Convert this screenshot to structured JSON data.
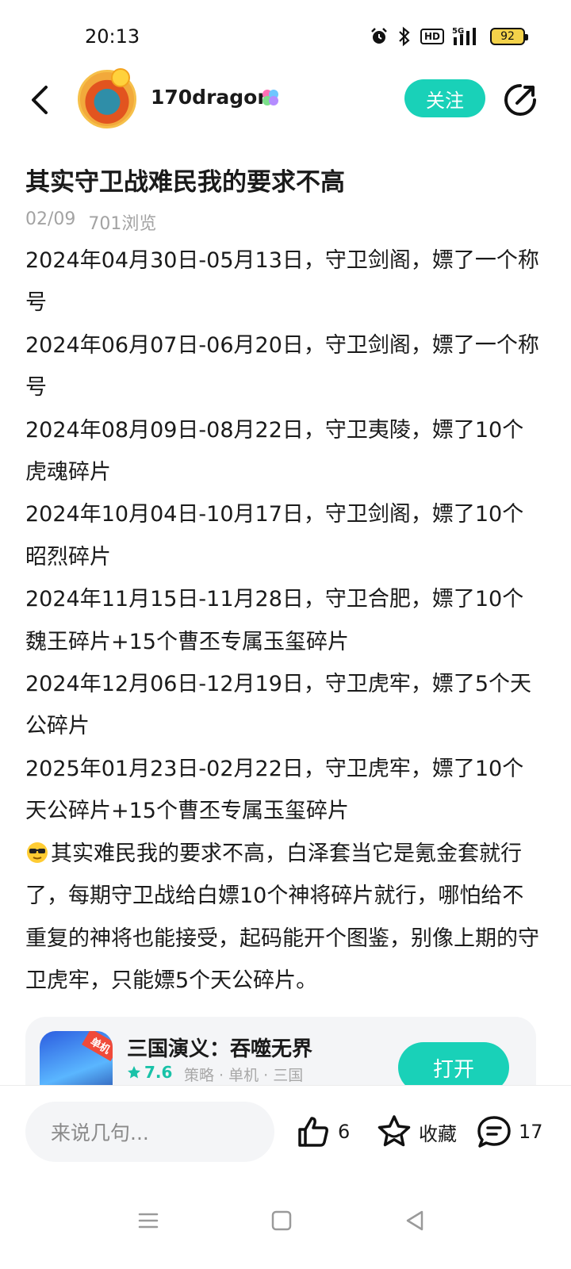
{
  "status_bar": {
    "time": "20:13",
    "network": "5G",
    "hd_label": "HD",
    "battery": "92",
    "icons": [
      "alarm-icon",
      "bluetooth-icon",
      "hd-icon",
      "signal-icon",
      "battery-icon"
    ]
  },
  "header": {
    "username": "170dragon",
    "follow_label": "关注",
    "icons": [
      "back-icon",
      "share-icon",
      "verify-badge-icon"
    ]
  },
  "post": {
    "title": "其实守卫战难民我的要求不高",
    "date": "02/09",
    "views": "701浏览",
    "paragraphs": [
      "2024年04月30日-05月13日，守卫剑阁，嫖了一个称号",
      "2024年06月07日-06月20日，守卫剑阁，嫖了一个称号",
      "2024年08月09日-08月22日，守卫夷陵，嫖了10个虎魂碎片",
      "2024年10月04日-10月17日，守卫剑阁，嫖了10个昭烈碎片",
      "2024年11月15日-11月28日，守卫合肥，嫖了10个魏王碎片+15个曹丕专属玉玺碎片",
      "2024年12月06日-12月19日，守卫虎牢，嫖了5个天公碎片",
      "2025年01月23日-02月22日，守卫虎牢，嫖了10个天公碎片+15个曹丕专属玉玺碎片"
    ],
    "final_paragraph": "其实难民我的要求不高，白泽套当它是氪金套就行了，每期守卫战给白嫖10个神将碎片就行，哪怕给不重复的神将也能接受，起码能开个图鉴，别像上期的守卫虎牢，只能嫖5个天公碎片。"
  },
  "app_card": {
    "name": "三国演义：吞噬无界",
    "rating": "7.6",
    "tags": "策略 · 单机 · 三国",
    "icon_tag": "单机",
    "open_label": "打开"
  },
  "bottom_bar": {
    "comment_placeholder": "来说几句...",
    "likes": "6",
    "favorite_label": "收藏",
    "comments": "17"
  },
  "colors": {
    "accent": "#19d1b8",
    "rating": "#19c2a8",
    "meta_text": "#a3a3a3",
    "card_bg": "#f4f5f7"
  }
}
